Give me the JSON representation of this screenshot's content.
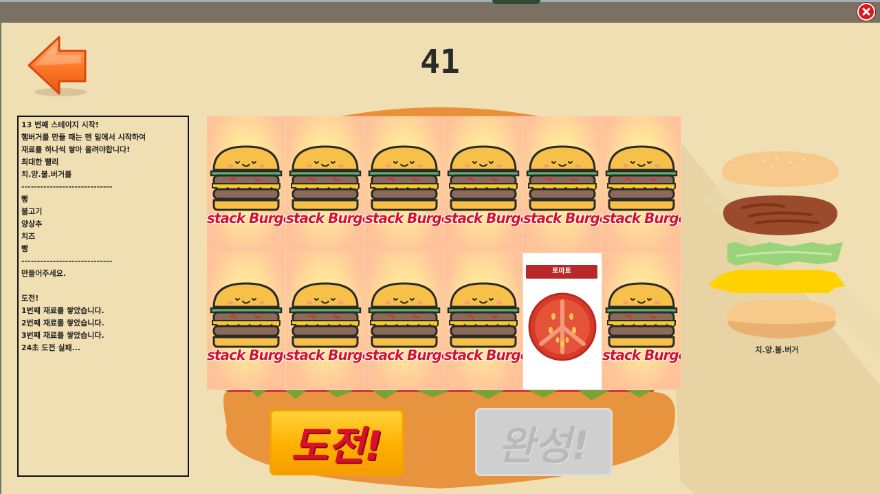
{
  "timer": "41",
  "log_lines": [
    "13 번째 스테이지 시작!",
    "햄버거를 만들 때는 맨 밑에서 시작하여",
    "재료를 하나씩 쌓아 올려야합니다!",
    "최대한 빨리",
    "치.양.불.버거를",
    "-----------------------------",
    "빵",
    "불고기",
    "양상추",
    "치즈",
    "빵",
    "-----------------------------",
    "만들어주세요.",
    "",
    "도전!",
    "1번째 재료를 쌓았습니다.",
    "2번째 재료를 쌓았습니다.",
    "3번째 재료를 쌓았습니다.",
    "24초 도전 실패..."
  ],
  "card_label": "stack Burger",
  "cards": [
    {
      "state": "back"
    },
    {
      "state": "back"
    },
    {
      "state": "back"
    },
    {
      "state": "back"
    },
    {
      "state": "back"
    },
    {
      "state": "back"
    },
    {
      "state": "back"
    },
    {
      "state": "back"
    },
    {
      "state": "back"
    },
    {
      "state": "back"
    },
    {
      "state": "front",
      "ingredient": "토마토"
    },
    {
      "state": "back"
    }
  ],
  "buttons": {
    "challenge_label": "도전!",
    "done_label": "완성!"
  },
  "target_burger_name": "치.양.불.버거",
  "colors": {
    "background": "#f1dfb4",
    "topbar": "#7b7163",
    "accent_red": "#d8102a",
    "button_yellow": "#ffb000",
    "button_disabled": "#cfcfcf"
  }
}
